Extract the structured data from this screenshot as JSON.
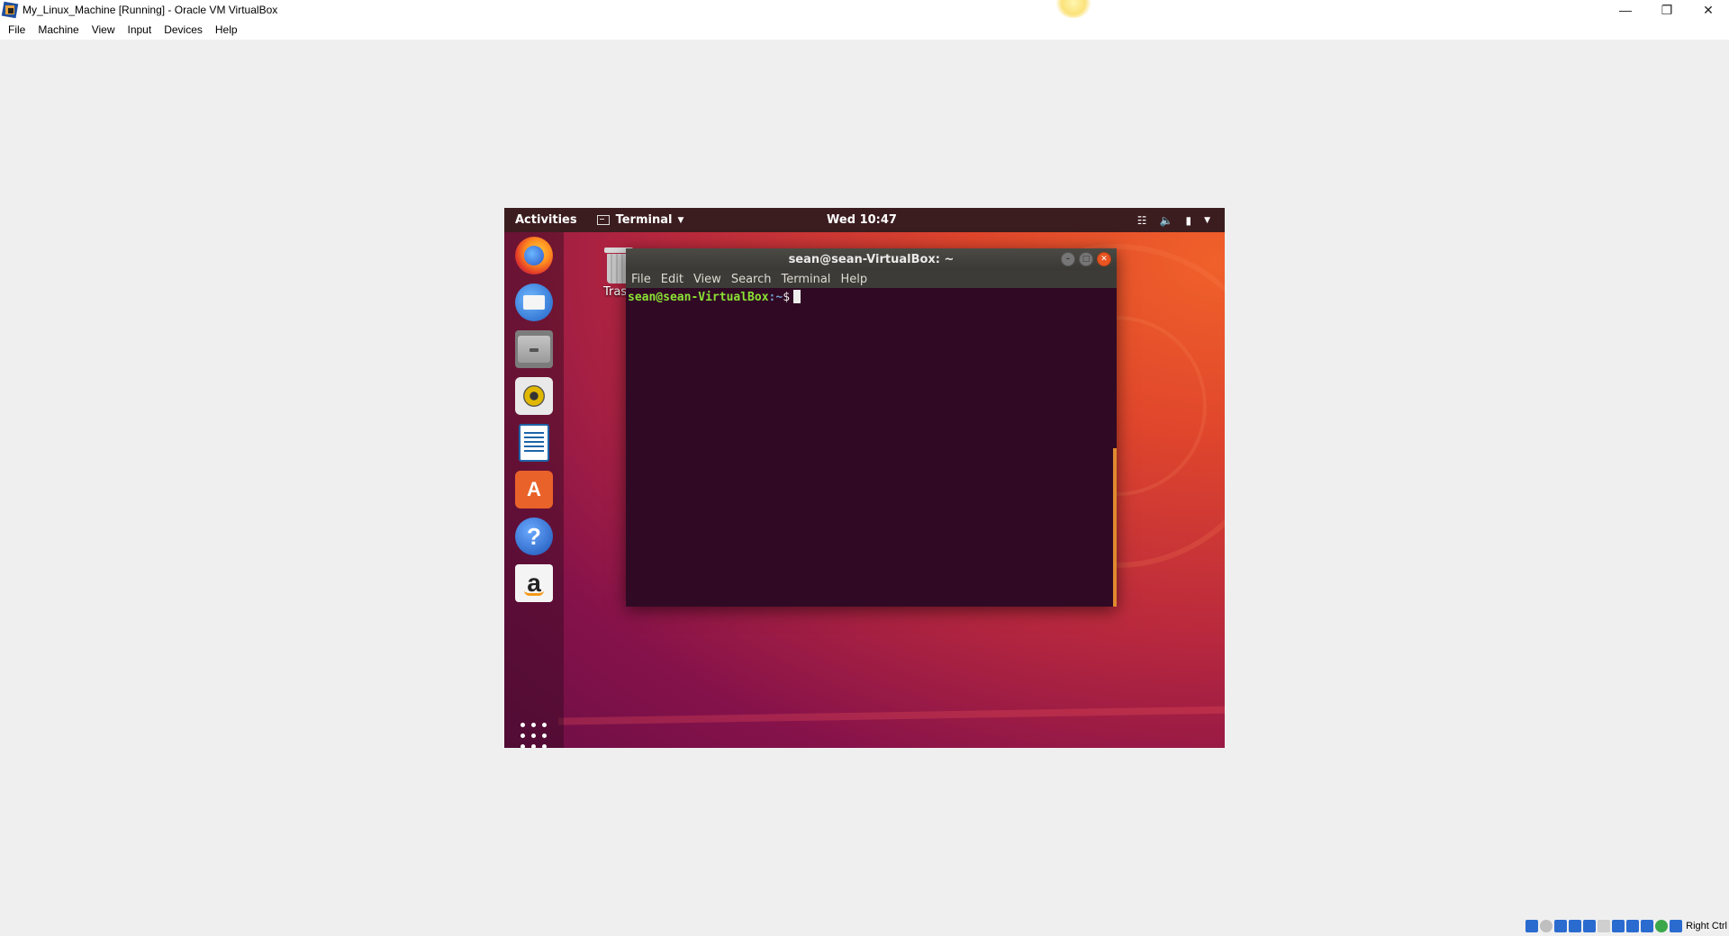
{
  "window": {
    "title": "My_Linux_Machine [Running] - Oracle VM VirtualBox",
    "controls": [
      "minimize",
      "restore",
      "close"
    ]
  },
  "host_menu": [
    "File",
    "Machine",
    "View",
    "Input",
    "Devices",
    "Help"
  ],
  "guest": {
    "topbar": {
      "activities": "Activities",
      "app_name": "Terminal",
      "clock": "Wed 10:47"
    },
    "dock": [
      "firefox",
      "thunderbird",
      "files",
      "rhythmbox",
      "libreoffice-writer",
      "ubuntu-software",
      "help",
      "amazon",
      "show-applications"
    ],
    "desktop": {
      "trash_label": "Trash"
    },
    "terminal": {
      "title": "sean@sean-VirtualBox: ~",
      "menu": [
        "File",
        "Edit",
        "View",
        "Search",
        "Terminal",
        "Help"
      ],
      "prompt_user": "sean@sean-VirtualBox",
      "prompt_path": ":~",
      "prompt_symbol": "$"
    }
  },
  "statusbar": {
    "host_key": "Right Ctrl",
    "icon_colors": [
      "#2a6bd0",
      "#bfbfbf",
      "#2a6bd0",
      "#2a6bd0",
      "#2a6bd0",
      "#cfcfcf",
      "#2a6bd0",
      "#2a6bd0",
      "#2a6bd0",
      "#3aa84a",
      "#2a6bd0"
    ]
  },
  "colors": {
    "terminal_bg": "#300a24",
    "prompt_user": "#8ae234",
    "prompt_path": "#729fcf",
    "ubuntu_orange": "#e95420"
  }
}
